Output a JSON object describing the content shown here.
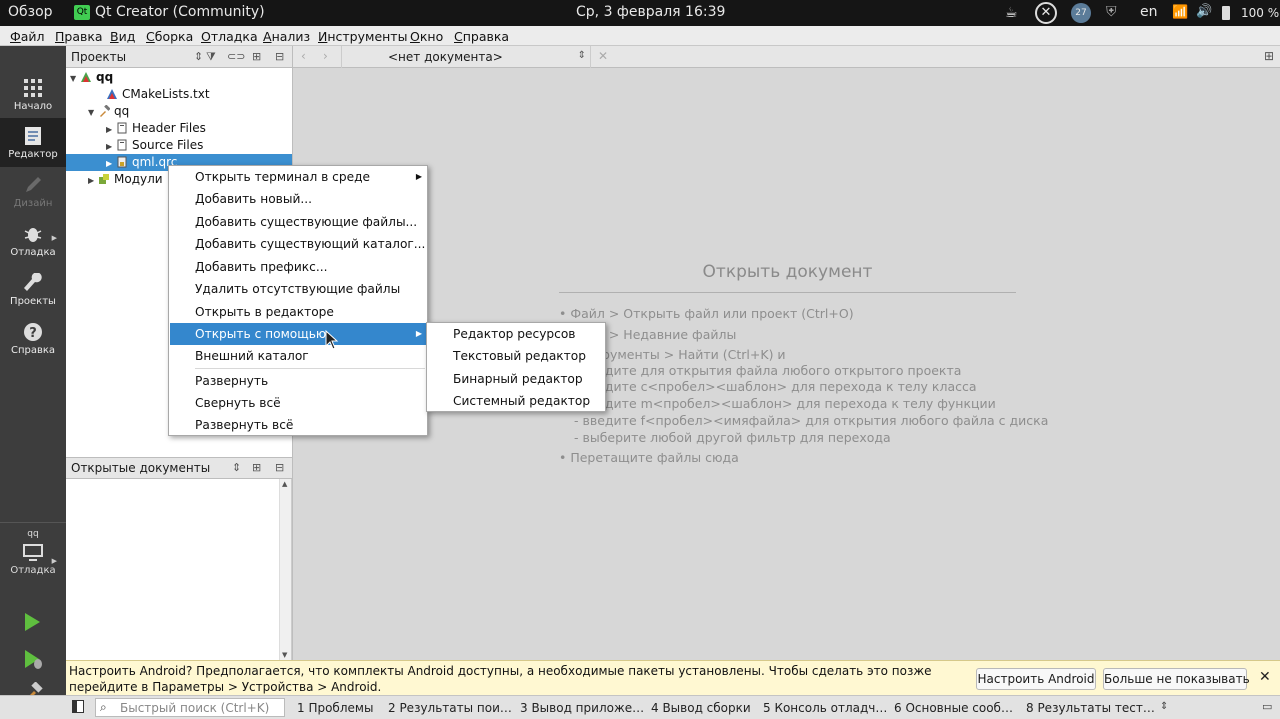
{
  "system_bar": {
    "overview": "Обзор",
    "app_badge": "Qt",
    "app_title": "Qt Creator (Community)",
    "datetime": "Ср, 3 февраля  16:39",
    "notif_count": "27",
    "lang": "en",
    "battery": "100 %"
  },
  "menubar": [
    "Файл",
    "Правка",
    "Вид",
    "Сборка",
    "Отладка",
    "Анализ",
    "Инструменты",
    "Окно",
    "Справка"
  ],
  "modes": [
    {
      "label": "Начало",
      "icon": "grid-icon"
    },
    {
      "label": "Редактор",
      "icon": "document-icon"
    },
    {
      "label": "Дизайн",
      "icon": "pencil-icon"
    },
    {
      "label": "Отладка",
      "icon": "bug-icon"
    },
    {
      "label": "Проекты",
      "icon": "wrench-icon"
    },
    {
      "label": "Справка",
      "icon": "help-icon"
    }
  ],
  "kit": {
    "project": "qq",
    "label": "Отладка"
  },
  "projects_panel": {
    "title": "Проекты"
  },
  "tree": [
    {
      "label": "qq",
      "bold": true
    },
    {
      "label": "CMakeLists.txt"
    },
    {
      "label": "qq"
    },
    {
      "label": "Header Files"
    },
    {
      "label": "Source Files"
    },
    {
      "label": "qml.qrc",
      "selected": true
    },
    {
      "label": "Модули"
    }
  ],
  "open_docs": {
    "title": "Открытые документы"
  },
  "editor": {
    "doc_selector": "<нет документа>",
    "heading": "Открыть документ",
    "hints": [
      "• Файл > Открыть файл или проект (Ctrl+O)",
      "• Файл > Недавние файлы",
      "• Инструменты > Найти (Ctrl+K) и",
      "- введите для открытия файла любого открытого проекта",
      "- введите c<пробел><шаблон> для перехода к телу класса",
      "- введите m<пробел><шаблон> для перехода к телу функции",
      "- введите f<пробел><имяфайла> для открытия любого файла с диска",
      "- выберите любой другой фильтр для перехода",
      "• Перетащите файлы сюда"
    ]
  },
  "context_menu": [
    "Открыть терминал в среде",
    "Добавить новый...",
    "Добавить существующие файлы...",
    "Добавить существующий каталог...",
    "Добавить префикс...",
    "Удалить отсутствующие файлы",
    "Открыть в редакторе",
    "Открыть с помощью",
    "Внешний каталог",
    "Развернуть",
    "Свернуть всё",
    "Развернуть всё"
  ],
  "submenu": [
    "Редактор ресурсов",
    "Текстовый редактор",
    "Бинарный редактор",
    "Системный редактор"
  ],
  "infobar": {
    "text": "Настроить Android? Предполагается, что комплекты Android доступны, а необходимые пакеты установлены. Чтобы сделать это позже перейдите в Параметры > Устройства > Android.",
    "btn_configure": "Настроить Android",
    "btn_dismiss": "Больше не показывать"
  },
  "statusbar": {
    "search_placeholder": "Быстрый поиск (Ctrl+K)",
    "tabs": [
      "1  Проблемы",
      "2  Результаты пои…",
      "3  Вывод приложе…",
      "4  Вывод сборки",
      "5  Консоль отладч…",
      "6  Основные сооб…",
      "8  Результаты тест…"
    ]
  },
  "colors": {
    "accent": "#3b8fd0",
    "leftbar": "#3d3d3d",
    "run_green": "#5fbf3f",
    "infobar": "#fff8d2"
  }
}
